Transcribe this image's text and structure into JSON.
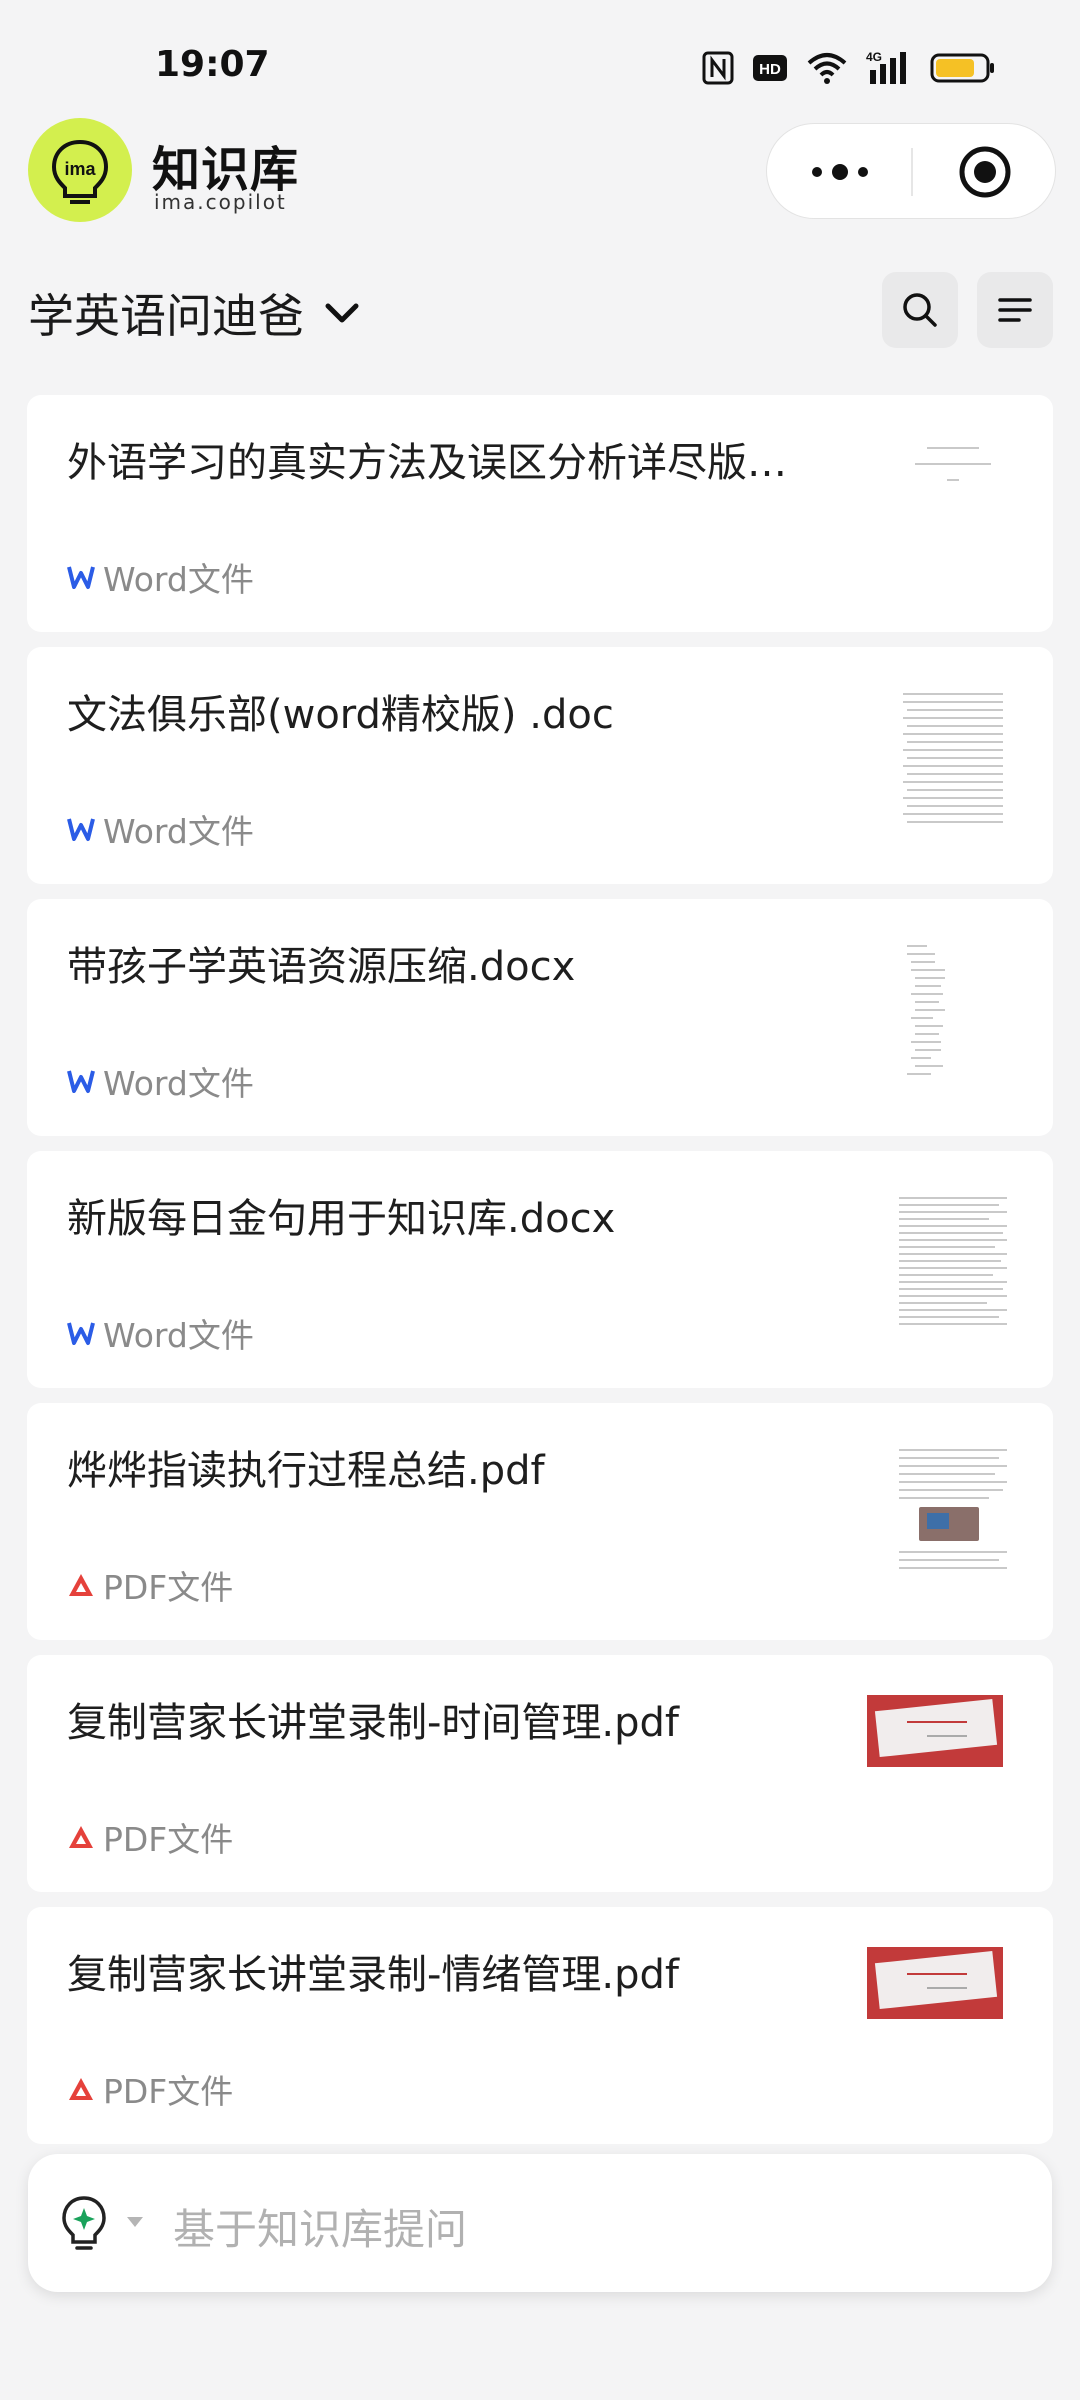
{
  "status_bar": {
    "time": "19:07",
    "icons": [
      "nfc-icon",
      "hd-icon",
      "wifi-icon",
      "signal-4g-icon",
      "battery-icon"
    ],
    "network_label": "4G",
    "hd_label": "HD"
  },
  "header": {
    "logo_text": "ima",
    "brand_title": "知识库",
    "brand_subtitle": "ima.copilot",
    "accent": "#d3ef4e"
  },
  "knowledge_base": {
    "name": "学英语问迪爸"
  },
  "documents": [
    {
      "title": "外语学习的真实方法及误区分析详尽版…",
      "type_label": "Word文件",
      "type": "word"
    },
    {
      "title": "文法俱乐部(word精校版) .doc",
      "type_label": "Word文件",
      "type": "word"
    },
    {
      "title": "带孩子学英语资源压缩.docx",
      "type_label": "Word文件",
      "type": "word"
    },
    {
      "title": "新版每日金句用于知识库.docx",
      "type_label": "Word文件",
      "type": "word"
    },
    {
      "title": "烨烨指读执行过程总结.pdf",
      "type_label": "PDF文件",
      "type": "pdf"
    },
    {
      "title": "复制营家长讲堂录制-时间管理.pdf",
      "type_label": "PDF文件",
      "type": "pdf"
    },
    {
      "title": "复制营家长讲堂录制-情绪管理.pdf",
      "type_label": "PDF文件",
      "type": "pdf"
    }
  ],
  "ask": {
    "placeholder": "基于知识库提问"
  },
  "colors": {
    "word_blue": "#2b5ce6",
    "pdf_red": "#e5413b",
    "ask_green": "#1aa25b"
  }
}
